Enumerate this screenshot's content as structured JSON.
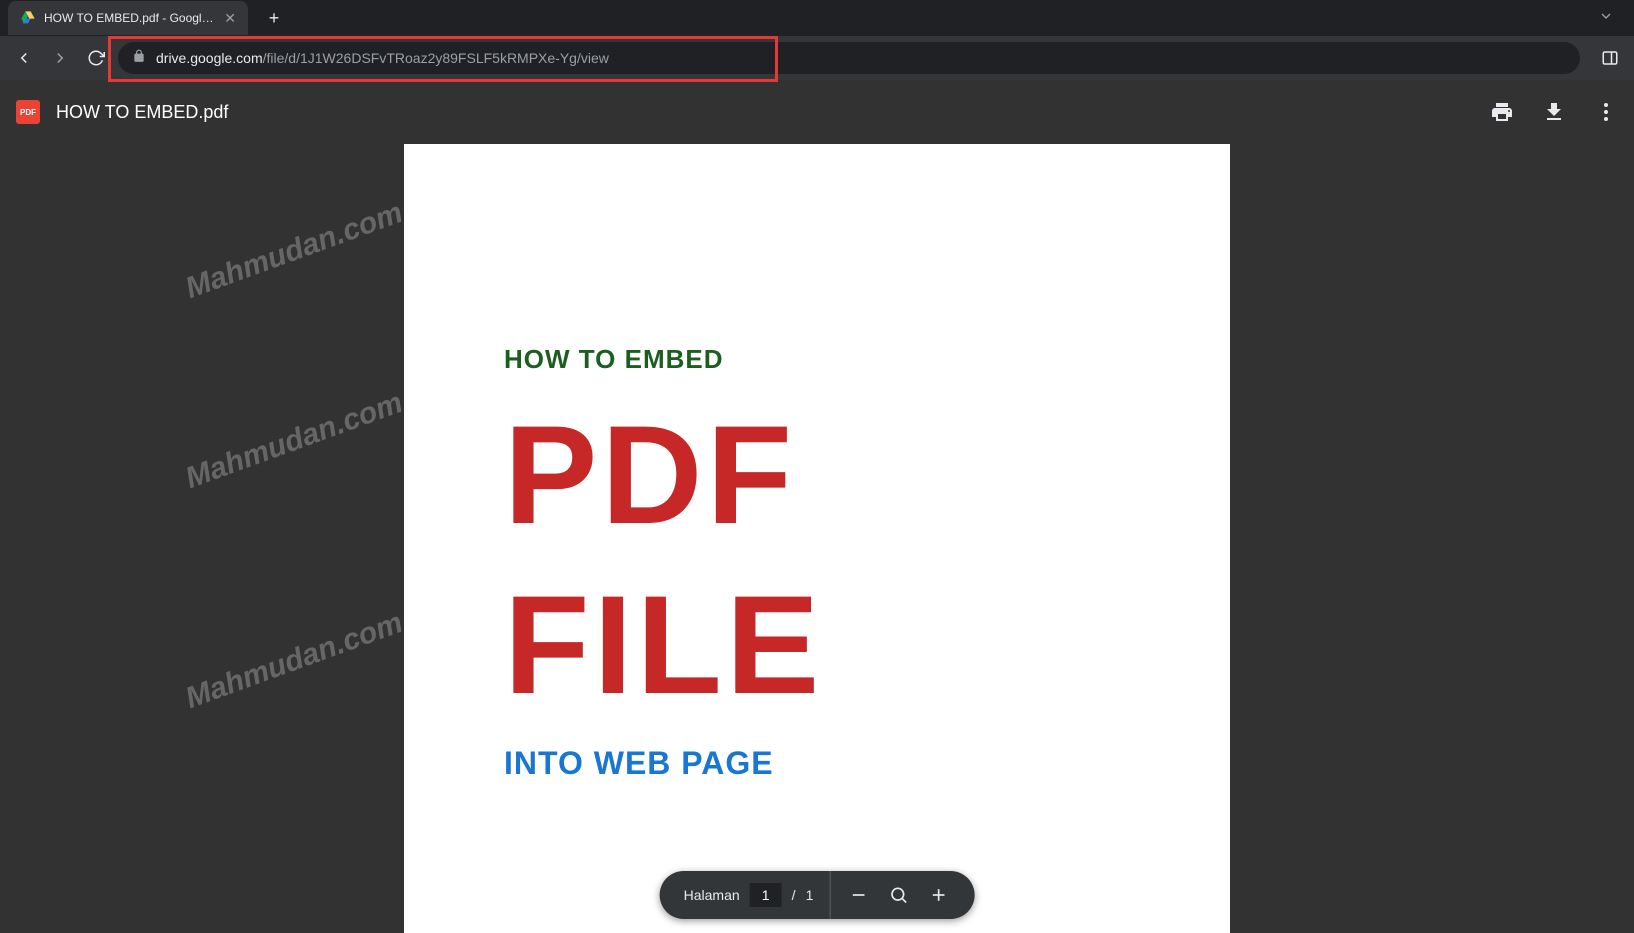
{
  "browser": {
    "tab_title": "HOW TO EMBED.pdf - Google D",
    "url_domain": "drive.google.com",
    "url_path": "/file/d/1J1W26DSFvTRoaz2y89FSLF5kRMPXe-Yg/view"
  },
  "viewer": {
    "pdf_badge": "PDF",
    "file_name": "HOW TO EMBED.pdf"
  },
  "document": {
    "heading": "HOW TO EMBED",
    "line1": "PDF",
    "line2": "FILE",
    "subtext": "INTO WEB PAGE"
  },
  "toolbar": {
    "page_label": "Halaman",
    "page_current": "1",
    "page_separator": "/",
    "page_total": "1"
  },
  "watermark": "Mahmudan.com"
}
